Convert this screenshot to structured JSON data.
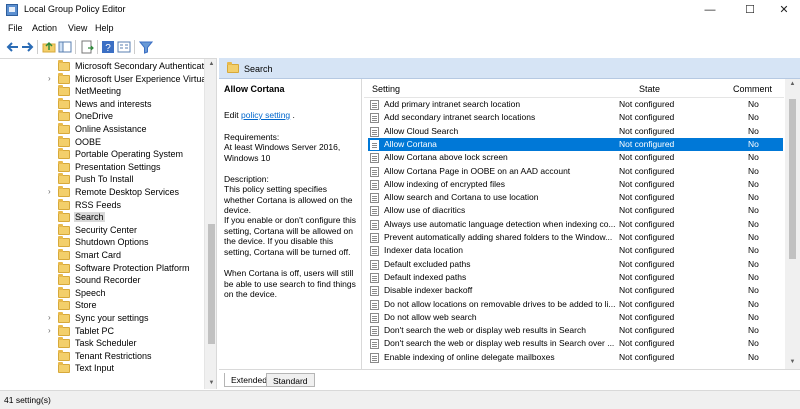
{
  "window": {
    "title": "Local Group Policy Editor",
    "minimize_glyph": "—",
    "maximize_glyph": "☐",
    "close_glyph": "✕"
  },
  "menu": [
    "File",
    "Action",
    "View",
    "Help"
  ],
  "toolbar": {
    "icons": [
      "back-arrow-icon",
      "forward-arrow-icon",
      "up-folder-icon",
      "show-hide-tree-icon",
      "export-list-icon",
      "help-icon",
      "properties-icon",
      "filter-icon"
    ]
  },
  "tree": {
    "items": [
      {
        "label": "Microsoft Secondary Authenticatio",
        "expandable": false
      },
      {
        "label": "Microsoft User Experience Virtualiz",
        "expandable": true
      },
      {
        "label": "NetMeeting",
        "expandable": false
      },
      {
        "label": "News and interests",
        "expandable": false
      },
      {
        "label": "OneDrive",
        "expandable": false
      },
      {
        "label": "Online Assistance",
        "expandable": false
      },
      {
        "label": "OOBE",
        "expandable": false
      },
      {
        "label": "Portable Operating System",
        "expandable": false
      },
      {
        "label": "Presentation Settings",
        "expandable": false
      },
      {
        "label": "Push To Install",
        "expandable": false
      },
      {
        "label": "Remote Desktop Services",
        "expandable": true
      },
      {
        "label": "RSS Feeds",
        "expandable": false
      },
      {
        "label": "Search",
        "expandable": false,
        "selected": true
      },
      {
        "label": "Security Center",
        "expandable": false
      },
      {
        "label": "Shutdown Options",
        "expandable": false
      },
      {
        "label": "Smart Card",
        "expandable": false
      },
      {
        "label": "Software Protection Platform",
        "expandable": false
      },
      {
        "label": "Sound Recorder",
        "expandable": false
      },
      {
        "label": "Speech",
        "expandable": false
      },
      {
        "label": "Store",
        "expandable": false
      },
      {
        "label": "Sync your settings",
        "expandable": true
      },
      {
        "label": "Tablet PC",
        "expandable": true
      },
      {
        "label": "Task Scheduler",
        "expandable": false
      },
      {
        "label": "Tenant Restrictions",
        "expandable": false
      },
      {
        "label": "Text Input",
        "expandable": false
      }
    ]
  },
  "header": {
    "path_title": "Search"
  },
  "description": {
    "title": "Allow Cortana",
    "edit_prefix": "Edit ",
    "edit_link": "policy setting",
    "edit_suffix": " .",
    "requirements_label": "Requirements:",
    "requirements_text": "At least Windows Server 2016, Windows 10",
    "description_label": "Description:",
    "description_text": "This policy setting specifies whether Cortana is allowed on the device.",
    "para_2": "If you enable or don't configure this setting, Cortana will be allowed on the device. If you disable this setting, Cortana will be turned off.",
    "para_3": "When Cortana is off, users will still be able to use search to find things on the device."
  },
  "list": {
    "columns": {
      "setting": "Setting",
      "state": "State",
      "comment": "Comment"
    },
    "rows": [
      {
        "setting": "Add primary intranet search location",
        "state": "Not configured",
        "comment": "No"
      },
      {
        "setting": "Add secondary intranet search locations",
        "state": "Not configured",
        "comment": "No"
      },
      {
        "setting": "Allow Cloud Search",
        "state": "Not configured",
        "comment": "No"
      },
      {
        "setting": "Allow Cortana",
        "state": "Not configured",
        "comment": "No",
        "selected": true
      },
      {
        "setting": "Allow Cortana above lock screen",
        "state": "Not configured",
        "comment": "No"
      },
      {
        "setting": "Allow Cortana Page in OOBE on an AAD account",
        "state": "Not configured",
        "comment": "No"
      },
      {
        "setting": "Allow indexing of encrypted files",
        "state": "Not configured",
        "comment": "No"
      },
      {
        "setting": "Allow search and Cortana to use location",
        "state": "Not configured",
        "comment": "No"
      },
      {
        "setting": "Allow use of diacritics",
        "state": "Not configured",
        "comment": "No"
      },
      {
        "setting": "Always use automatic language detection when indexing co...",
        "state": "Not configured",
        "comment": "No"
      },
      {
        "setting": "Prevent automatically adding shared folders to the Window...",
        "state": "Not configured",
        "comment": "No"
      },
      {
        "setting": "Indexer data location",
        "state": "Not configured",
        "comment": "No"
      },
      {
        "setting": "Default excluded paths",
        "state": "Not configured",
        "comment": "No"
      },
      {
        "setting": "Default indexed paths",
        "state": "Not configured",
        "comment": "No"
      },
      {
        "setting": "Disable indexer backoff",
        "state": "Not configured",
        "comment": "No"
      },
      {
        "setting": "Do not allow locations on removable drives to be added to li...",
        "state": "Not configured",
        "comment": "No"
      },
      {
        "setting": "Do not allow web search",
        "state": "Not configured",
        "comment": "No"
      },
      {
        "setting": "Don't search the web or display web results in Search",
        "state": "Not configured",
        "comment": "No"
      },
      {
        "setting": "Don't search the web or display web results in Search over ...",
        "state": "Not configured",
        "comment": "No"
      },
      {
        "setting": "Enable indexing of online delegate mailboxes",
        "state": "Not configured",
        "comment": "No"
      }
    ]
  },
  "tabs": [
    {
      "label": "Extended",
      "active": true
    },
    {
      "label": "Standard",
      "active": false
    }
  ],
  "status": {
    "text": "41 setting(s)"
  },
  "colors": {
    "selection": "#0078d7",
    "header_band": "#d6e4f5",
    "link": "#0066cc"
  }
}
